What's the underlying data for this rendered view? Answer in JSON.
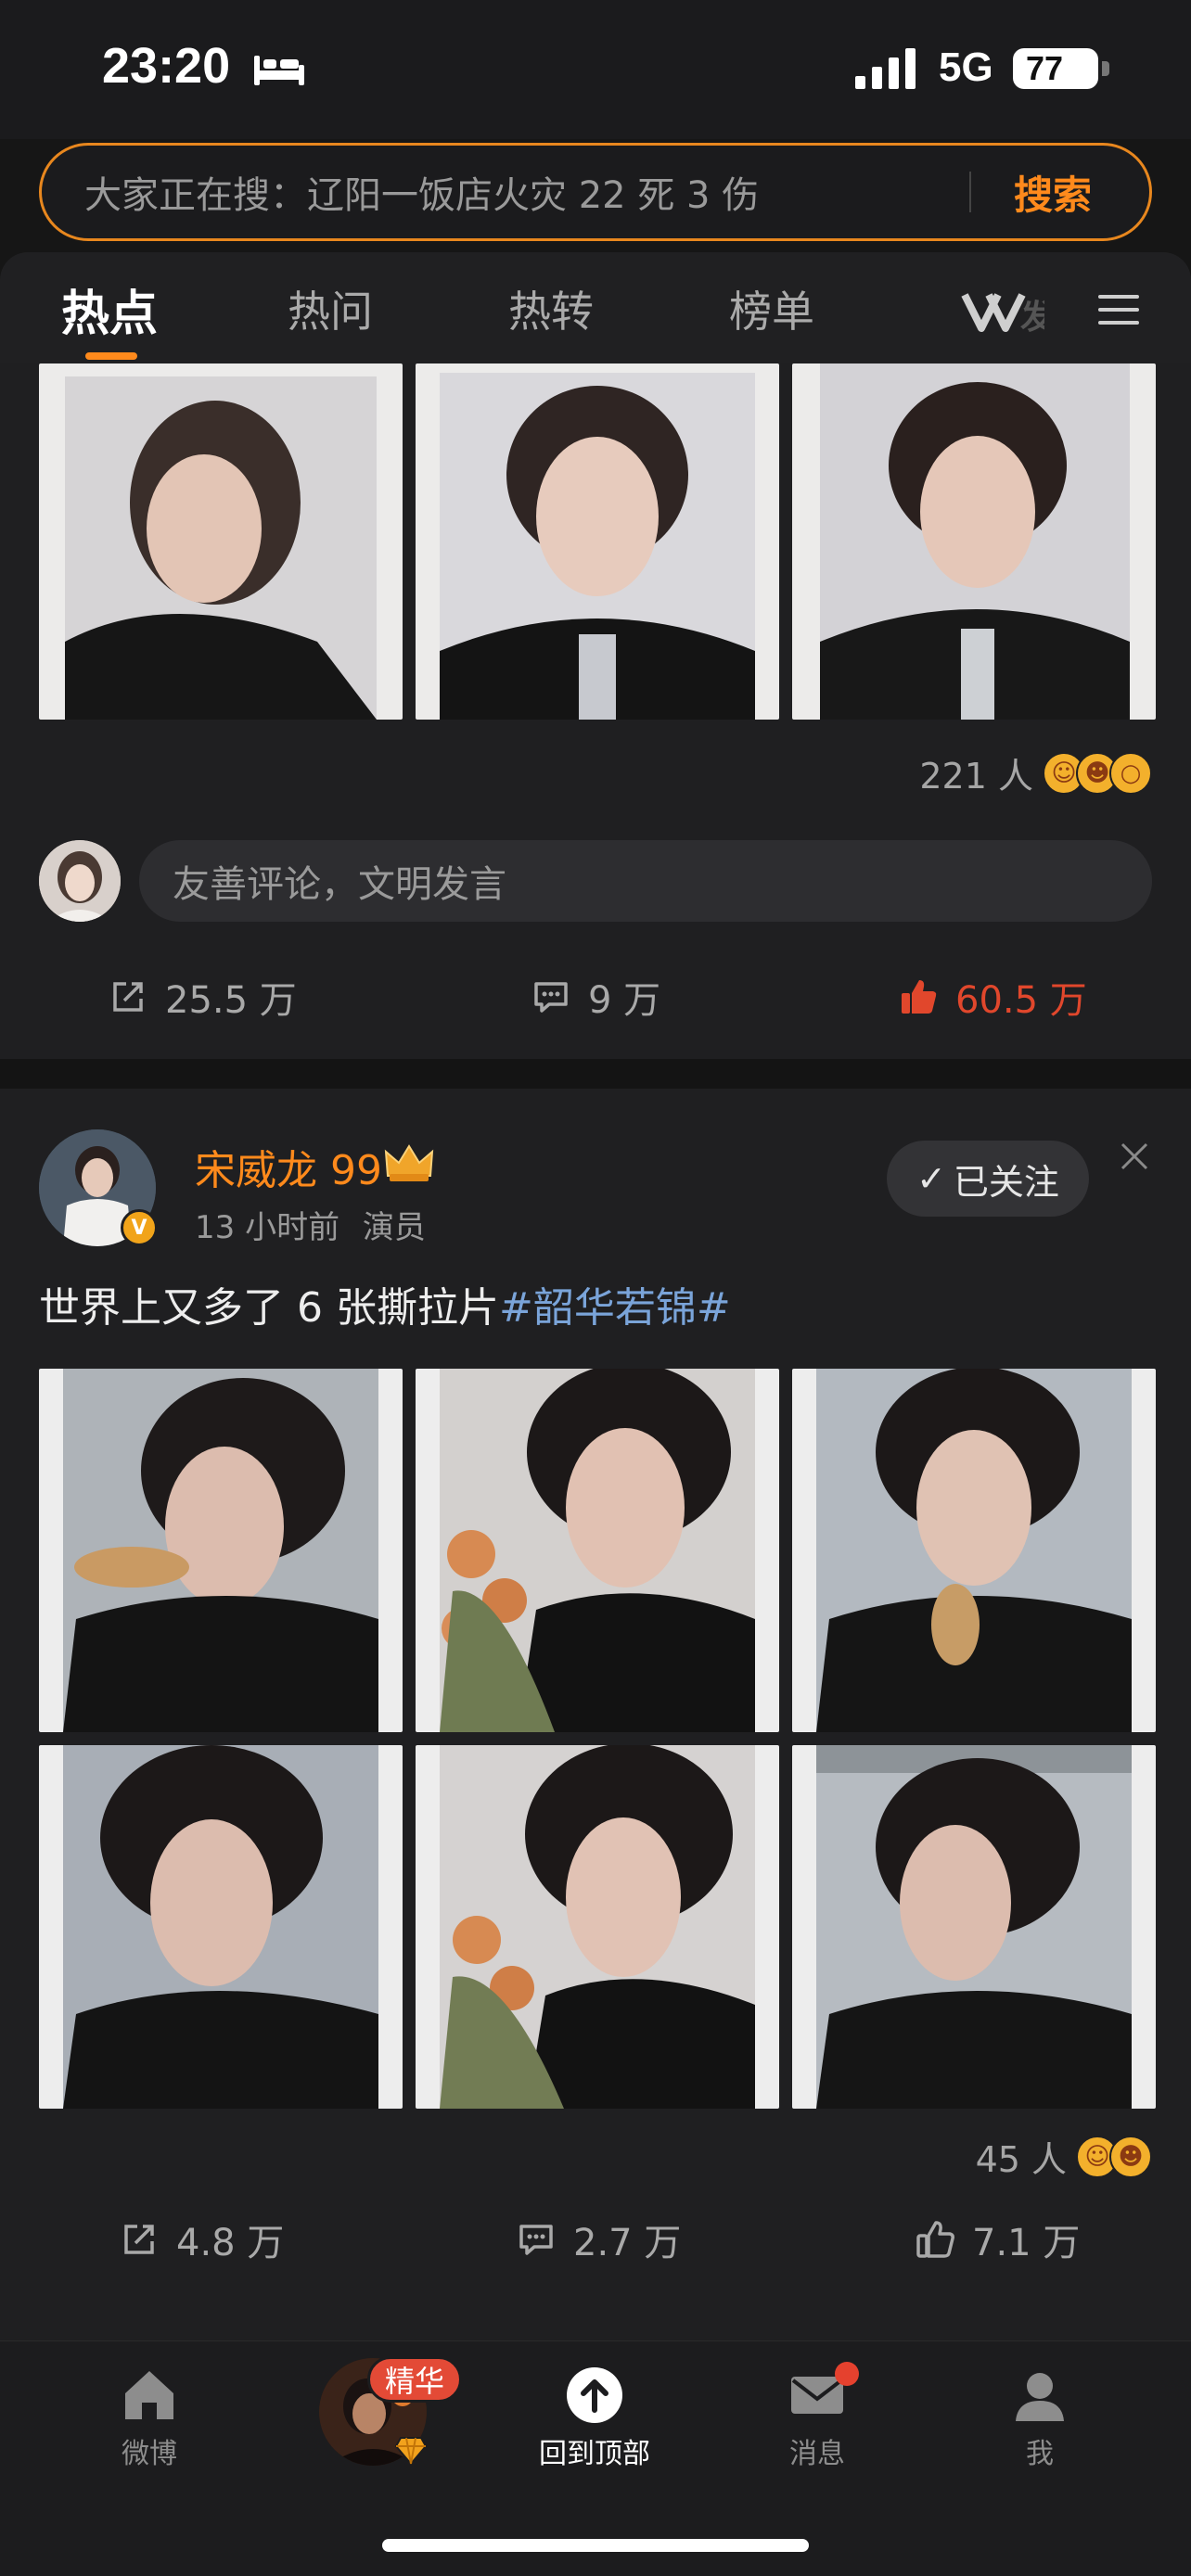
{
  "status_bar": {
    "time": "23:20",
    "network": "5G",
    "battery": "77"
  },
  "search": {
    "placeholder": "大家正在搜：辽阳一饭店火灾 22 死 3 伤",
    "button": "搜索"
  },
  "tabs": [
    "热点",
    "热问",
    "热转",
    "榜单"
  ],
  "post1": {
    "reaction_count": "221 人",
    "comment_placeholder": "友善评论，文明发言",
    "reposts": "25.5 万",
    "comments": "9 万",
    "likes": "60.5 万"
  },
  "post2": {
    "author": "宋威龙 99",
    "time": "13 小时前",
    "role": "演员",
    "follow": "已关注",
    "text": "世界上又多了 6 张撕拉片",
    "hashtag": "#韶华若锦#",
    "reaction_count": "45 人",
    "reposts": "4.8 万",
    "comments": "2.7 万",
    "likes": "7.1 万"
  },
  "bottom_nav": {
    "weibo": "微博",
    "featured_badge": "精华",
    "back_to_top": "回到顶部",
    "messages": "消息",
    "me": "我"
  },
  "colors": {
    "accent": "#ff8a1c",
    "like_active": "#e1472c",
    "hashtag": "#7aa4d9",
    "background": "#1f1f21"
  }
}
